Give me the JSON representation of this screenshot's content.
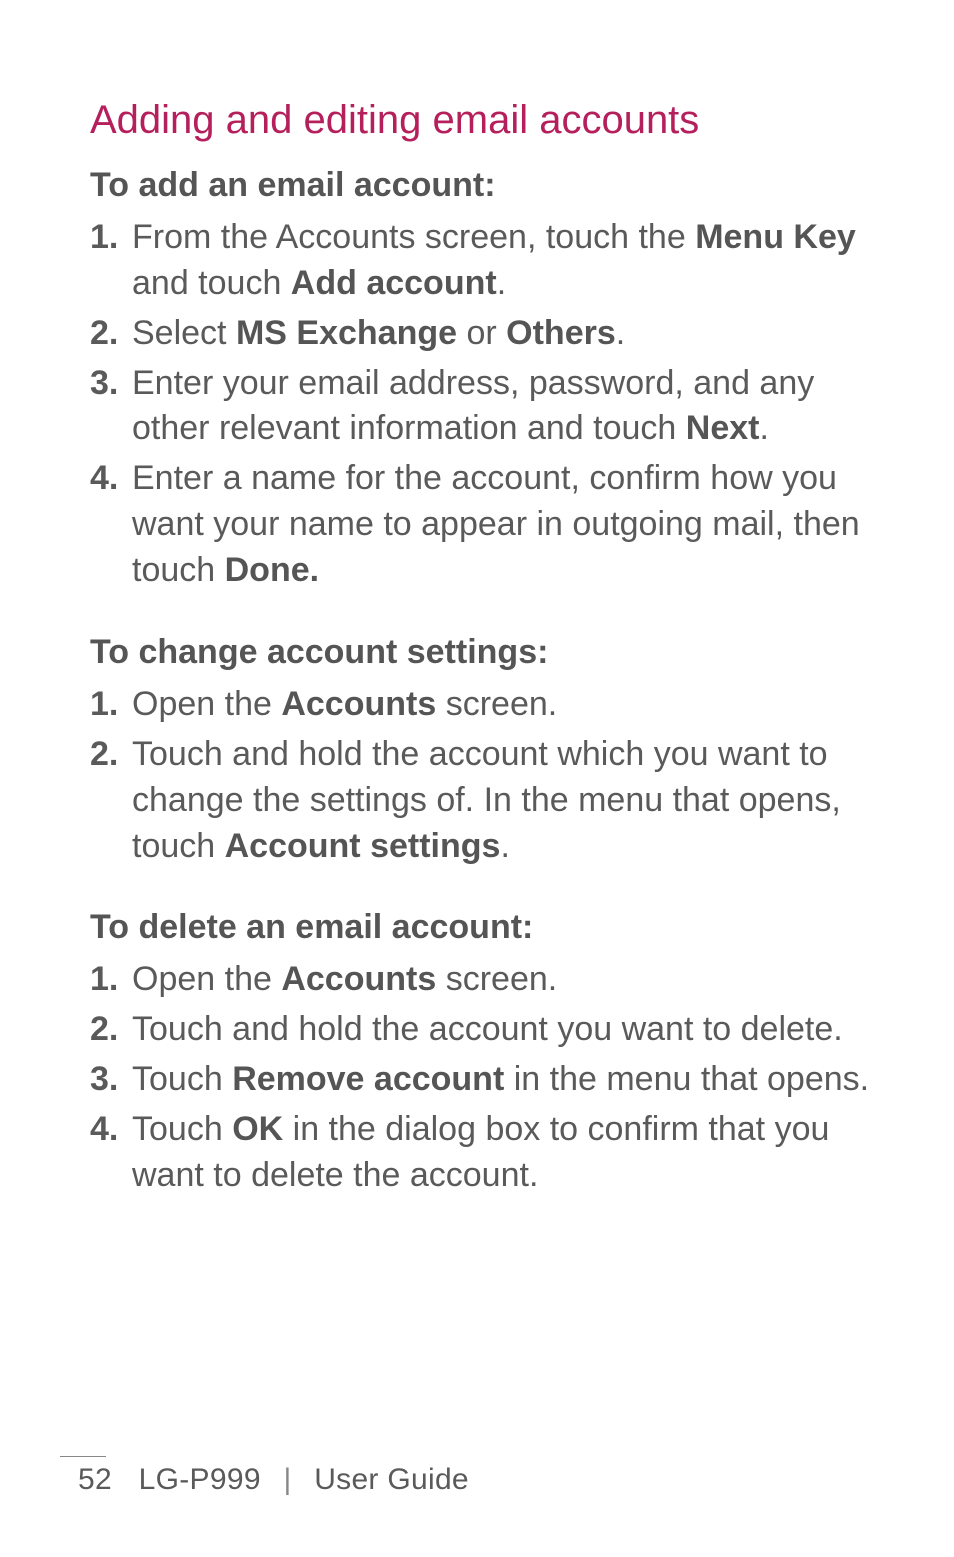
{
  "title": "Adding and editing email accounts",
  "section1": {
    "heading": "To add an email account:",
    "steps": [
      {
        "pre": "From the Accounts screen, touch the ",
        "b1": "Menu Key",
        "mid": " and touch ",
        "b2": "Add account",
        "post": "."
      },
      {
        "pre": "Select ",
        "b1": "MS Exchange",
        "mid": " or ",
        "b2": "Others",
        "post": "."
      },
      {
        "pre": "Enter your email address, password, and any other relevant information and touch ",
        "b1": "Next",
        "post": "."
      },
      {
        "pre": "Enter a name for the account, confirm how you want your name to appear in outgoing mail, then touch ",
        "b1": "Done."
      }
    ]
  },
  "section2": {
    "heading": "To change account settings:",
    "steps": [
      {
        "pre": "Open the ",
        "b1": "Accounts",
        "post": " screen."
      },
      {
        "pre": "Touch and hold the account which you want to change the settings of. In the menu that opens, touch ",
        "b1": "Account settings",
        "post": "."
      }
    ]
  },
  "section3": {
    "heading": "To delete an email account:",
    "steps": [
      {
        "pre": "Open the ",
        "b1": "Accounts",
        "post": " screen."
      },
      {
        "pre": "Touch and hold the account you want to delete."
      },
      {
        "pre": "Touch ",
        "b1": "Remove account",
        "post": " in the menu that opens."
      },
      {
        "pre": "Touch ",
        "b1": "OK",
        "post": " in the dialog box to confirm that you want to delete the account."
      }
    ]
  },
  "footer": {
    "page": "52",
    "model": "LG-P999",
    "label": "User Guide"
  }
}
